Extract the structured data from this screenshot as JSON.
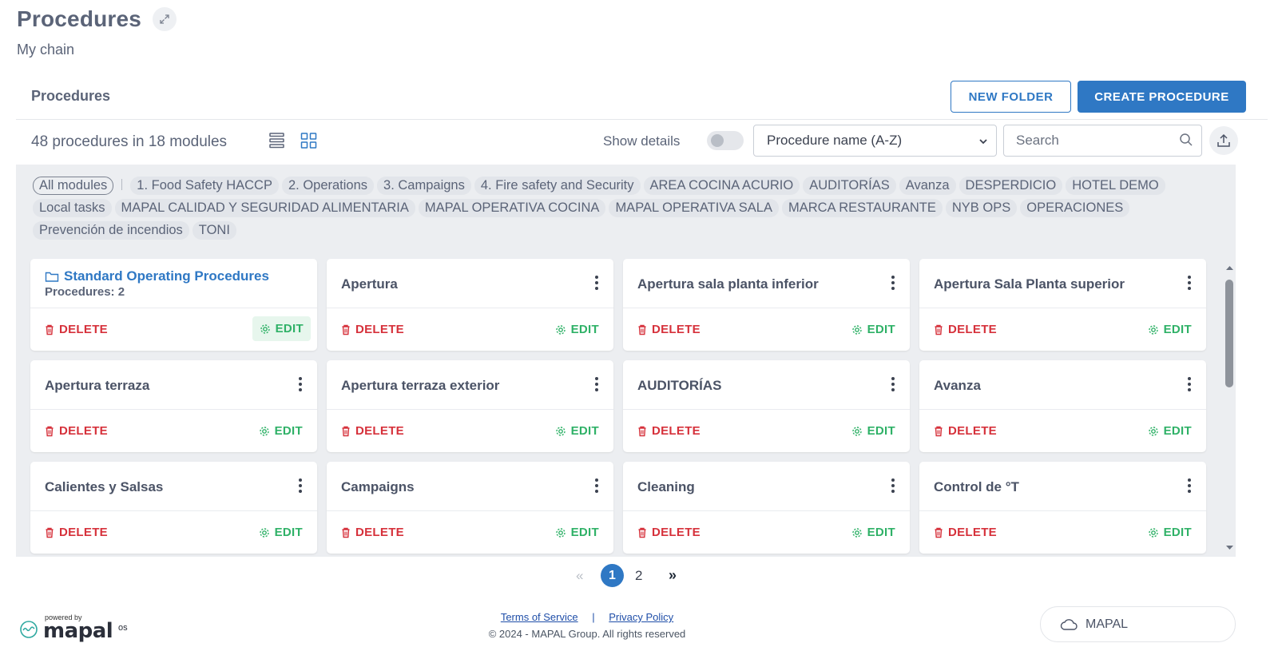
{
  "header": {
    "title": "Procedures",
    "subtitle": "My chain"
  },
  "section": {
    "title": "Procedures",
    "new_folder_label": "NEW FOLDER",
    "create_label": "CREATE PROCEDURE"
  },
  "toolbar": {
    "count_text": "48 procedures in 18 modules",
    "show_details_label": "Show details",
    "show_details_on": false,
    "sort_value": "Procedure name (A-Z)",
    "search_placeholder": "Search"
  },
  "filters": [
    "All modules",
    "1. Food Safety HACCP",
    "2. Operations",
    "3. Campaigns",
    "4. Fire safety and Security",
    "AREA COCINA ACURIO",
    "AUDITORÍAS",
    "Avanza",
    "DESPERDICIO",
    "HOTEL DEMO",
    "Local tasks",
    "MAPAL CALIDAD Y SEGURIDAD ALIMENTARIA",
    "MAPAL OPERATIVA COCINA",
    "MAPAL OPERATIVA SALA",
    "MARCA RESTAURANTE",
    "NYB OPS",
    "OPERACIONES",
    "Prevención de incendios",
    "TONI"
  ],
  "folder_card": {
    "title": "Standard Operating Procedures",
    "count_text": "Procedures: 2",
    "delete_label": "DELETE",
    "edit_label": "EDIT"
  },
  "cards": [
    {
      "title": "Apertura",
      "delete_label": "DELETE",
      "edit_label": "EDIT"
    },
    {
      "title": "Apertura sala planta inferior",
      "delete_label": "DELETE",
      "edit_label": "EDIT"
    },
    {
      "title": "Apertura Sala Planta superior",
      "delete_label": "DELETE",
      "edit_label": "EDIT"
    },
    {
      "title": "Apertura terraza",
      "delete_label": "DELETE",
      "edit_label": "EDIT"
    },
    {
      "title": "Apertura terraza exterior",
      "delete_label": "DELETE",
      "edit_label": "EDIT"
    },
    {
      "title": "AUDITORÍAS",
      "delete_label": "DELETE",
      "edit_label": "EDIT"
    },
    {
      "title": "Avanza",
      "delete_label": "DELETE",
      "edit_label": "EDIT"
    },
    {
      "title": "Calientes y Salsas",
      "delete_label": "DELETE",
      "edit_label": "EDIT"
    },
    {
      "title": "Campaigns",
      "delete_label": "DELETE",
      "edit_label": "EDIT"
    },
    {
      "title": "Cleaning",
      "delete_label": "DELETE",
      "edit_label": "EDIT"
    },
    {
      "title": "Control de °T",
      "delete_label": "DELETE",
      "edit_label": "EDIT"
    }
  ],
  "pagination": {
    "prev": "«",
    "current": "1",
    "page2": "2",
    "next": "»"
  },
  "footer": {
    "powered_by": "powered by",
    "brand": "mapal",
    "brand_suffix": "os",
    "terms": "Terms of Service",
    "separator": "|",
    "privacy": "Privacy Policy",
    "copyright": "© 2024 - MAPAL Group. All rights reserved",
    "app_button": "MAPAL"
  },
  "colors": {
    "accent": "#2f78c4",
    "danger": "#d6313b",
    "success": "#2fb167"
  }
}
